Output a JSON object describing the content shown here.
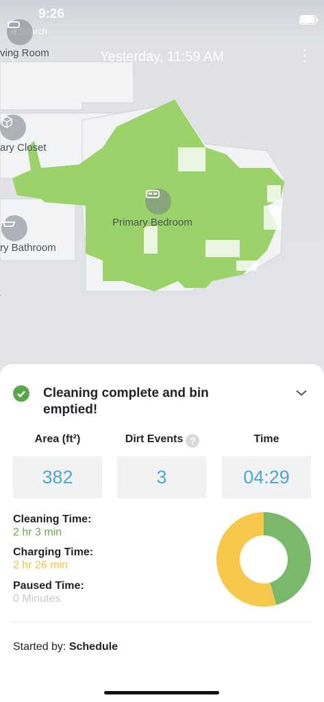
{
  "status_bar": {
    "time": "9:26",
    "back_label": "◀ Search"
  },
  "header": {
    "title": "Yesterday, 11:59 AM"
  },
  "map": {
    "rooms": [
      {
        "label": "ving Room",
        "icon": "sofa-icon"
      },
      {
        "label": "ary Closet",
        "icon": "closet-icon"
      },
      {
        "label": "Primary Bedroom",
        "icon": "bed-icon"
      },
      {
        "label": "ry Bathroom",
        "icon": "bathtub-icon"
      }
    ],
    "cleaned_color": "#9bd36a"
  },
  "summary": {
    "status_message": "Cleaning complete and bin emptied!",
    "stats": [
      {
        "label": "Area (ft²)",
        "value": "382"
      },
      {
        "label": "Dirt Events",
        "value": "3"
      },
      {
        "label": "Time",
        "value": "04:29"
      }
    ],
    "times": [
      {
        "label": "Cleaning Time:",
        "value": "2 hr 3 min",
        "color": "#6aa84f"
      },
      {
        "label": "Charging Time:",
        "value": "2 hr 26 min",
        "color": "#f0c13d"
      },
      {
        "label": "Paused Time:",
        "value": "0 Minutes",
        "color": "#c7c9cc"
      }
    ],
    "donut": [
      {
        "name": "Cleaning",
        "minutes": 123,
        "color": "#7ab86b"
      },
      {
        "name": "Charging",
        "minutes": 146,
        "color": "#f6c84b"
      },
      {
        "name": "Paused",
        "minutes": 0,
        "color": "#c7c9cc"
      }
    ],
    "started_by_label": "Started by:",
    "started_by_value": "Schedule"
  }
}
